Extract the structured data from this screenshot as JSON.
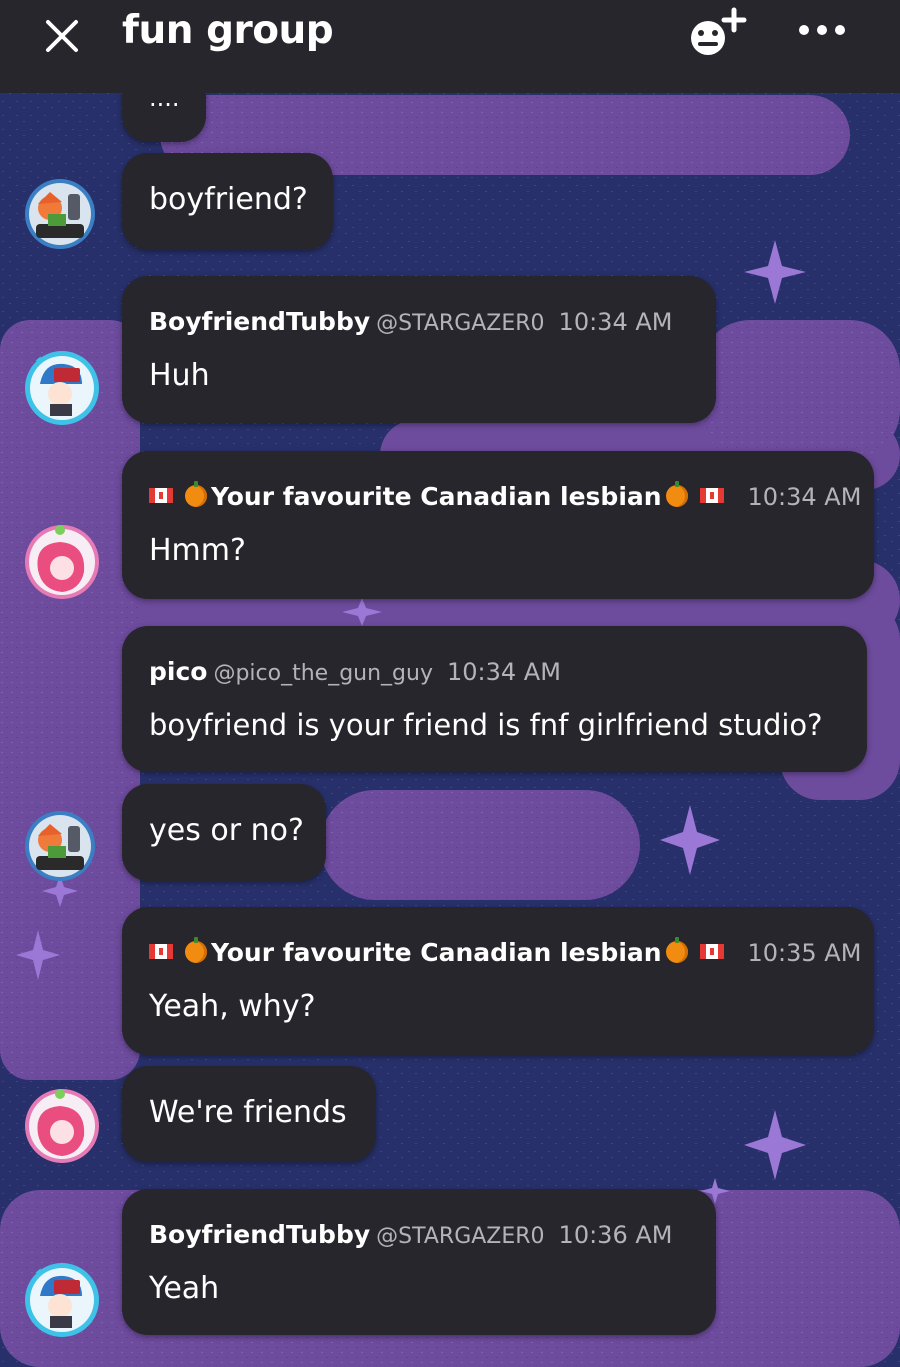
{
  "header": {
    "title": "fun group"
  },
  "messages": [
    {
      "text": "...."
    },
    {
      "text": "boyfriend?"
    },
    {
      "name": "BoyfriendTubby",
      "handle": "@STARGAZER0",
      "time": "10:34 AM",
      "text": "Huh"
    },
    {
      "name": "Your favourite Canadian lesbian",
      "time": "10:34 AM",
      "text": "Hmm?"
    },
    {
      "name": "pico",
      "handle": "@pico_the_gun_guy",
      "time": "10:34 AM",
      "text": "boyfriend is your friend is fnf girlfriend studio?"
    },
    {
      "text": "yes or no?"
    },
    {
      "name": "Your favourite Canadian lesbian",
      "time": "10:35 AM",
      "text": "Yeah, why?"
    },
    {
      "text": "We're friends"
    },
    {
      "name": "BoyfriendTubby",
      "handle": "@STARGAZER0",
      "time": "10:36 AM",
      "text": "Yeah"
    }
  ],
  "colors": {
    "header_bg": "#26262c",
    "bubble_bg": "#26262c",
    "background_blue": "#27306a",
    "cloud_purple": "#6d4b9d"
  },
  "icons": [
    "close-icon",
    "add-member-icon",
    "more-icon",
    "canada-flag-icon",
    "pumpkin-icon",
    "sparkle-star-icon"
  ]
}
